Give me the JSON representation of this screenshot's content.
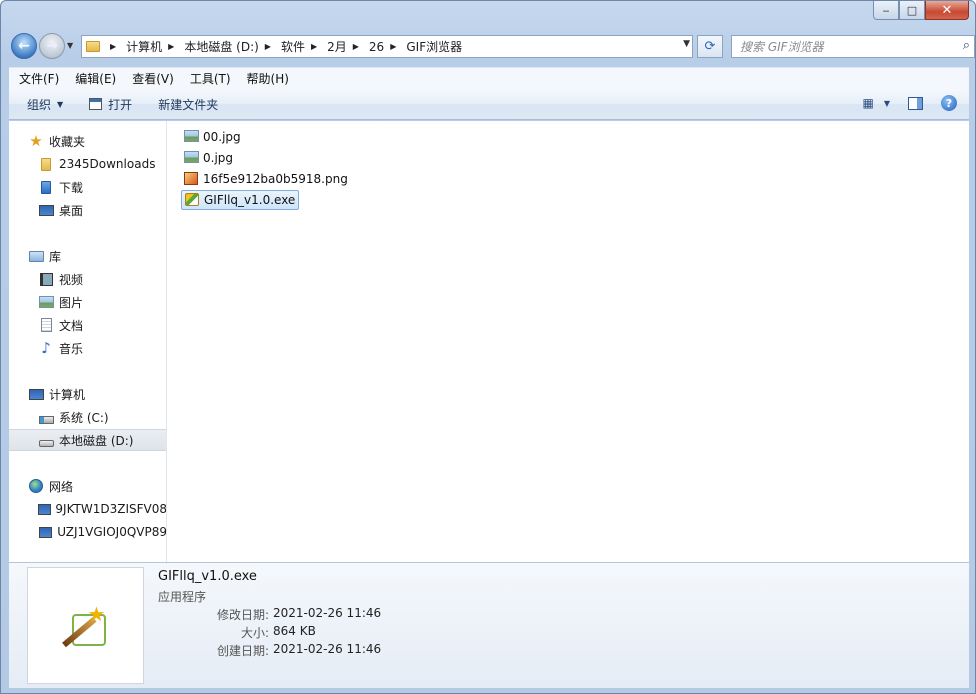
{
  "window": {
    "caption": {
      "minimize": "‒",
      "maximize": "□",
      "close": "✕"
    }
  },
  "nav": {
    "back_icon": "back-arrow-icon",
    "forward_icon": "forward-arrow-icon",
    "breadcrumbs": [
      "计算机",
      "本地磁盘 (D:)",
      "软件",
      "2月",
      "26",
      "GIF浏览器"
    ],
    "search_placeholder": "搜索 GIF浏览器"
  },
  "menu": [
    "文件(F)",
    "编辑(E)",
    "查看(V)",
    "工具(T)",
    "帮助(H)"
  ],
  "commands": {
    "organize": "组织",
    "open": "打开",
    "new_folder": "新建文件夹"
  },
  "sidebar": {
    "favorites": {
      "label": "收藏夹",
      "items": [
        "2345Downloads",
        "下载",
        "桌面"
      ]
    },
    "libraries": {
      "label": "库",
      "items": [
        "视频",
        "图片",
        "文档",
        "音乐"
      ]
    },
    "computer": {
      "label": "计算机",
      "items": [
        "系统 (C:)",
        "本地磁盘 (D:)"
      ]
    },
    "network": {
      "label": "网络",
      "items": [
        "9JKTW1D3ZISFV08",
        "UZJ1VGIOJ0QVP89"
      ]
    }
  },
  "files": [
    {
      "name": "00.jpg",
      "icon": "image-file-icon"
    },
    {
      "name": "0.jpg",
      "icon": "image-file-icon"
    },
    {
      "name": "16f5e912ba0b5918.png",
      "icon": "png-file-icon"
    },
    {
      "name": "GIFllq_v1.0.exe",
      "icon": "exe-file-icon",
      "selected": true
    }
  ],
  "details": {
    "name": "GIFllq_v1.0.exe",
    "type": "应用程序",
    "props": [
      {
        "label": "修改日期:",
        "value": "2021-02-26 11:46"
      },
      {
        "label": "大小:",
        "value": "864 KB"
      },
      {
        "label": "创建日期:",
        "value": "2021-02-26 11:46"
      }
    ]
  }
}
